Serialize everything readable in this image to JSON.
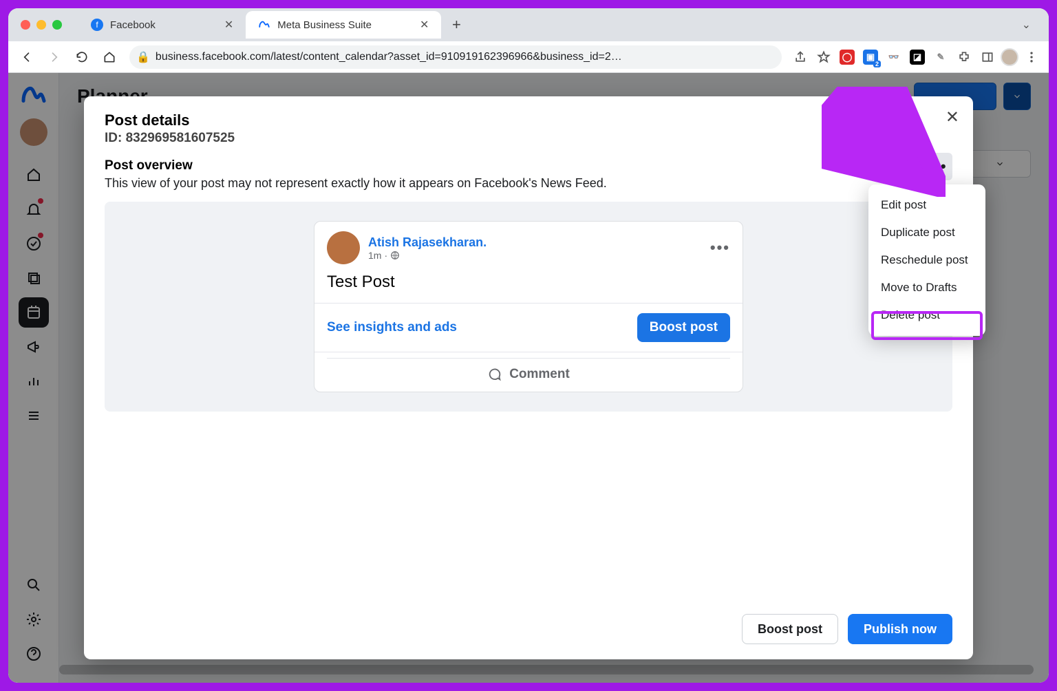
{
  "browser": {
    "tabs": [
      {
        "label": "Facebook",
        "active": false
      },
      {
        "label": "Meta Business Suite",
        "active": true
      }
    ],
    "url": "business.facebook.com/latest/content_calendar?asset_id=910919162396966&business_id=2…"
  },
  "page": {
    "title": "Planner"
  },
  "modal": {
    "title": "Post details",
    "id_label": "ID: 832969581607525",
    "overview_title": "Post overview",
    "overview_desc": "This view of your post may not represent exactly how it appears on Facebook's News Feed.",
    "more_btn_glyph": "•••"
  },
  "post": {
    "author": "Atish Rajasekharan.",
    "timestamp": "1m",
    "privacy_dot": "·",
    "body": "Test Post",
    "insights_label": "See insights and ads",
    "boost_label": "Boost post",
    "comment_label": "Comment",
    "menu_glyph": "•••"
  },
  "footer": {
    "boost": "Boost post",
    "publish": "Publish now"
  },
  "dropdown": {
    "items": [
      "Edit post",
      "Duplicate post",
      "Reschedule post",
      "Move to Drafts",
      "Delete post"
    ],
    "highlight_index": 4
  }
}
